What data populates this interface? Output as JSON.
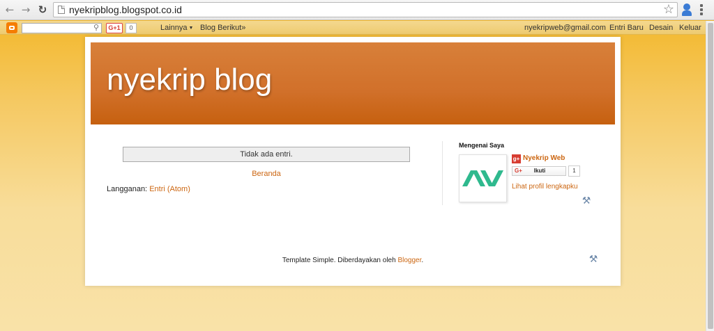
{
  "browser": {
    "url": "nyekripblog.blogspot.co.id",
    "back_icon": "back-arrow-icon",
    "forward_icon": "forward-arrow-icon",
    "reload_icon": "reload-icon"
  },
  "navbar": {
    "gplus_label": "G+1",
    "gplus_count": "0",
    "more_label": "Lainnya",
    "next_blog_label": "Blog Berikut»",
    "email": "nyekripweb@gmail.com",
    "new_post_label": "Entri Baru",
    "design_label": "Desain",
    "logout_label": "Keluar"
  },
  "blog": {
    "title": "nyekrip blog"
  },
  "main": {
    "no_posts_text": "Tidak ada entri.",
    "home_link": "Beranda",
    "subscribe_label": "Langganan:",
    "subscribe_link": "Entri (Atom)"
  },
  "sidebar": {
    "about_title": "Mengenai Saya",
    "profile_name": "Nyekrip Web",
    "follow_label": "Ikuti",
    "follow_count": "1",
    "view_profile_link": "Lihat profil lengkapku"
  },
  "footer": {
    "text": "Template Simple. Diberdayakan oleh",
    "link": "Blogger",
    "suffix": "."
  },
  "colors": {
    "accent": "#cc6611",
    "header": "#d1702a",
    "logo_green": "#2fb98e"
  }
}
